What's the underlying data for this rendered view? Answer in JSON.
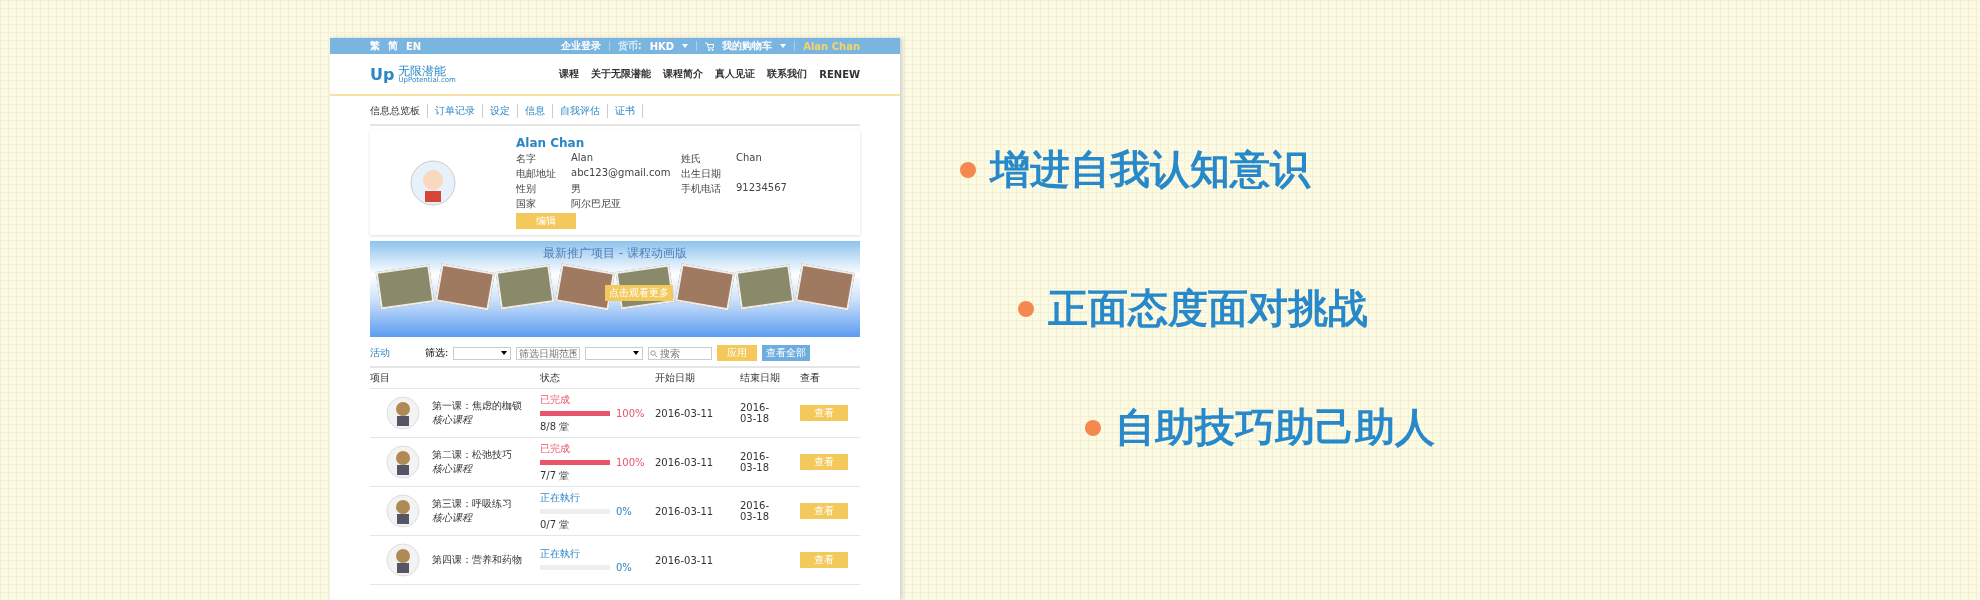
{
  "top_bar": {
    "languages": [
      "繁",
      "简",
      "EN"
    ],
    "corporate_login": "企业登录",
    "currency_label": "货币:",
    "currency": "HKD",
    "cart": "我的购物车",
    "user": "Alan Chan"
  },
  "header": {
    "logo": {
      "mark": "Up",
      "name": "无限潜能",
      "domain": "UpPotential.com"
    },
    "nav": [
      "课程",
      "关于无限潜能",
      "课程简介",
      "真人见证",
      "联系我们",
      "RENEW"
    ]
  },
  "tabs": [
    {
      "label": "信息总览板",
      "selected": true
    },
    {
      "label": "订单记录",
      "selected": false
    },
    {
      "label": "设定",
      "selected": false
    },
    {
      "label": "信息",
      "selected": false
    },
    {
      "label": "自我评估",
      "selected": false
    },
    {
      "label": "证书",
      "selected": false
    }
  ],
  "profile": {
    "name": "Alan Chan",
    "fields": [
      {
        "label": "名字",
        "value": "Alan"
      },
      {
        "label": "姓氏",
        "value": "Chan"
      },
      {
        "label": "电邮地址",
        "value": "abc123@gmail.com"
      },
      {
        "label": "出生日期"
      },
      {
        "label": "性别",
        "value": "男"
      },
      {
        "label": "手机电话",
        "value": "91234567"
      },
      {
        "label": "国家",
        "value": "阿尔巴尼亚"
      }
    ],
    "edit_button": "编辑"
  },
  "promo": {
    "title": "最新推广项目 - 课程动画版",
    "button": "点击观看更多"
  },
  "activities": {
    "title": "活动",
    "filter_label": "筛选:",
    "date_placeholder": "筛选日期范围",
    "search_placeholder": "搜索",
    "apply_button": "应用",
    "view_all_button": "查看全部"
  },
  "table": {
    "columns": [
      "项目",
      "状态",
      "开始日期",
      "结束日期",
      "查看"
    ],
    "rows": [
      {
        "lesson": "第一课：焦虑的枷锁",
        "category": "核心课程",
        "kind": "done",
        "status": "已完成",
        "level": 1,
        "percent": "100%",
        "sessions": "8/8 堂",
        "start": "2016-03-11",
        "end": "2016-03-18",
        "button": "查看"
      },
      {
        "lesson": "第二课：松弛技巧",
        "category": "核心课程",
        "kind": "done",
        "status": "已完成",
        "level": 1,
        "percent": "100%",
        "sessions": "7/7 堂",
        "start": "2016-03-11",
        "end": "2016-03-18",
        "button": "查看"
      },
      {
        "lesson": "第三课：呼吸练习",
        "category": "核心课程",
        "kind": "in_progress",
        "status": "正在執行",
        "level": 0,
        "percent": "0%",
        "sessions": "0/7 堂",
        "start": "2016-03-11",
        "end": "2016-03-18",
        "button": "查看"
      },
      {
        "lesson": "第四课：营养和药物",
        "kind": "in_progress",
        "status": "正在執行",
        "level": 0,
        "percent": "0%",
        "start": "2016-03-11",
        "button": "查看"
      }
    ]
  },
  "bullets": [
    "增进自我认知意识",
    "正面态度面对挑战",
    "自助技巧助己助人"
  ]
}
